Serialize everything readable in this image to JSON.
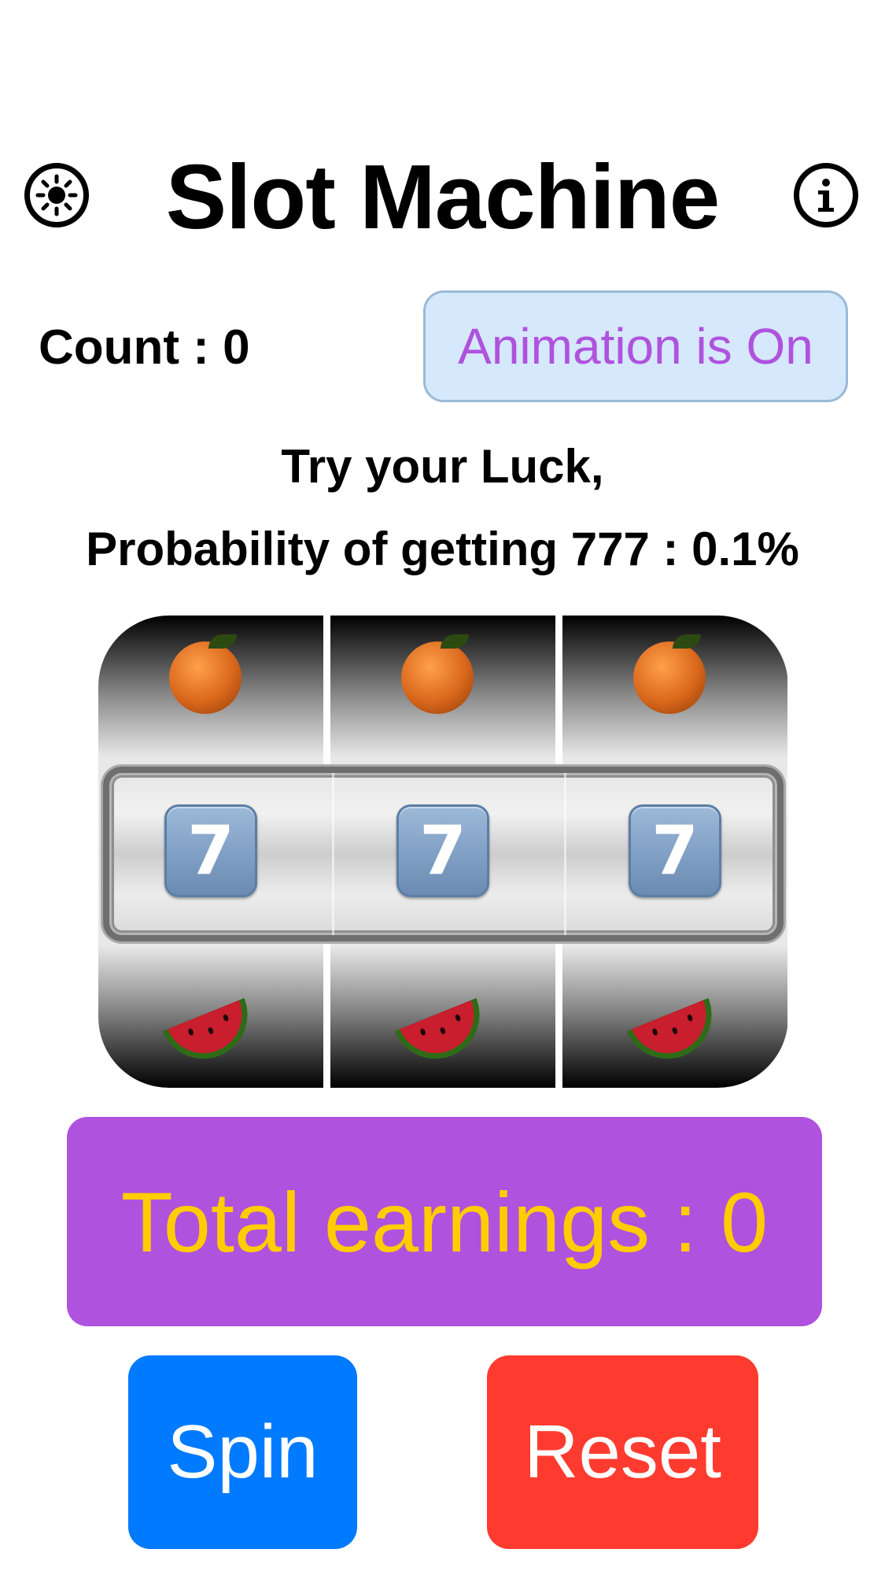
{
  "header": {
    "title": "Slot Machine",
    "settings_icon": "sun-gear-icon",
    "info_icon": "info-icon"
  },
  "status": {
    "count_text": "Count : 0",
    "animation_label": "Animation is On"
  },
  "subtitle": {
    "line1": "Try your Luck,",
    "line2": "Probability of getting 777 : 0.1%"
  },
  "reels": [
    {
      "top": "orange",
      "center": "7",
      "bottom": "watermelon"
    },
    {
      "top": "orange",
      "center": "7",
      "bottom": "watermelon"
    },
    {
      "top": "orange",
      "center": "7",
      "bottom": "watermelon"
    }
  ],
  "earnings": {
    "text": "Total earnings : 0"
  },
  "actions": {
    "spin_label": "Spin",
    "reset_label": "Reset"
  },
  "colors": {
    "purple": "#af52de",
    "gold": "#ffcc00",
    "blue": "#007aff",
    "red": "#ff3b30",
    "toggle_bg": "#d6e8fc"
  }
}
